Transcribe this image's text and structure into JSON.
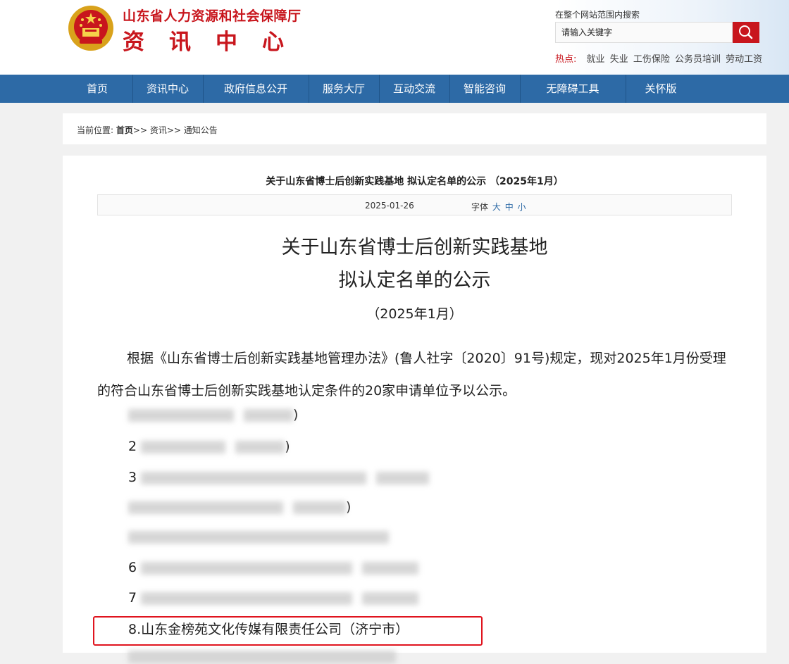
{
  "header": {
    "site_name": "山东省人力资源和社会保障厅",
    "section_name": "资讯中心",
    "search_scope": "在整个网站范围内搜索",
    "search_placeholder": "请输入关键字",
    "hot_label": "热点:",
    "hot_links": [
      "就业",
      "失业",
      "工伤保险",
      "公务员培训",
      "劳动工资"
    ]
  },
  "nav": [
    "首页",
    "资讯中心",
    "政府信息公开",
    "服务大厅",
    "互动交流",
    "智能咨询",
    "无障碍工具",
    "关怀版"
  ],
  "breadcrumb": {
    "prefix": "当前位置:",
    "items": [
      "首页",
      "资讯",
      "通知公告"
    ],
    "separator": ">>"
  },
  "article": {
    "header_title": "关于山东省博士后创新实践基地 拟认定名单的公示  （2025年1月）",
    "date": "2025-01-26",
    "font_label": "字体",
    "font_sizes": [
      "大",
      "中",
      "小"
    ],
    "title_line1": "关于山东省博士后创新实践基地",
    "title_line2": "拟认定名单的公示",
    "title_date": "（2025年1月）",
    "intro": "根据《山东省博士后创新实践基地管理办法》(鲁人社字〔2020〕91号)规定，现对2025年1月份受理的符合山东省博士后创新实践基地认定条件的20家申请单位予以公示。",
    "list_items": [
      {
        "visible_prefix": "",
        "visible_suffix": ")"
      },
      {
        "visible_prefix": "2",
        "visible_suffix": ")"
      },
      {
        "visible_prefix": "3",
        "visible_suffix": ""
      },
      {
        "visible_prefix": "",
        "visible_suffix": ")"
      },
      {
        "visible_prefix": "",
        "visible_suffix": ""
      },
      {
        "visible_prefix": "6",
        "visible_suffix": ""
      },
      {
        "visible_prefix": "7",
        "visible_suffix": ""
      },
      {
        "visible_prefix": "8.山东金榜苑文化传媒有限责任公司（济宁市）",
        "visible_suffix": ""
      }
    ]
  },
  "colors": {
    "brand_red": "#c8161d",
    "nav_blue": "#2d6aa6",
    "highlight_red": "#e0141e"
  }
}
